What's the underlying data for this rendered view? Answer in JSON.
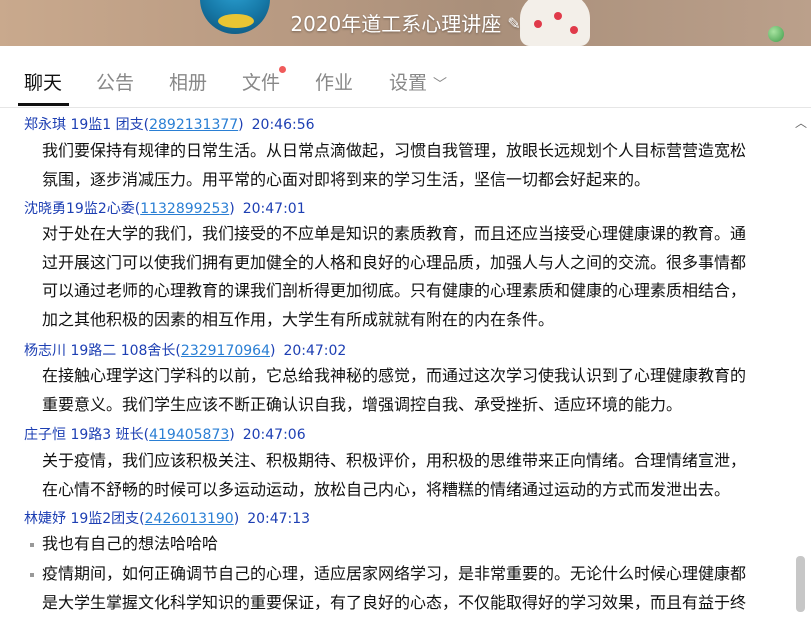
{
  "header": {
    "title": "2020年道工系心理讲座",
    "edit_icon": "pencil-icon"
  },
  "tabs": [
    {
      "label": "聊天",
      "active": true
    },
    {
      "label": "公告",
      "active": false
    },
    {
      "label": "相册",
      "active": false
    },
    {
      "label": "文件",
      "active": false,
      "badge_dot": true
    },
    {
      "label": "作业",
      "active": false
    },
    {
      "label": "设置",
      "active": false,
      "has_dropdown": true
    }
  ],
  "messages": [
    {
      "sender": "郑永琪 19监1 团支(",
      "qq": "2892131377",
      "sender_suffix": ")",
      "time": "20:46:56",
      "lines": [
        "我们要保持有规律的日常生活。从日常点滴做起，习惯自我管理，放眼长远规划个人目标营营造宽松",
        "氛围，逐步消减压力。用平常的心面对即将到来的学习生活，坚信一切都会好起来的。"
      ]
    },
    {
      "sender": "沈晓勇19监2心委(",
      "qq": "1132899253",
      "sender_suffix": ")",
      "time": "20:47:01",
      "lines": [
        "对于处在大学的我们，我们接受的不应单是知识的素质教育，而且还应当接受心理健康课的教育。通",
        "过开展这门可以使我们拥有更加健全的人格和良好的心理品质，加强人与人之间的交流。很多事情都",
        "可以通过老师的心理教育的课我们剖析得更加彻底。只有健康的心理素质和健康的心理素质相结合，",
        "加之其他积极的因素的相互作用，大学生有所成就就有附在的内在条件。"
      ]
    },
    {
      "sender": "杨志川  19路二  108舍长(",
      "qq": "2329170964",
      "sender_suffix": ")",
      "time": "20:47:02",
      "lines": [
        "在接触心理学这门学科的以前，它总给我神秘的感觉，而通过这次学习使我认识到了心理健康教育的",
        "重要意义。我们学生应该不断正确认识自我，增强调控自我、承受挫折、适应环境的能力。"
      ]
    },
    {
      "sender": "庄子恒 19路3 班长(",
      "qq": "419405873",
      "sender_suffix": ")",
      "time": "20:47:06",
      "lines": [
        "关于疫情，我们应该积极关注、积极期待、积极评价，用积极的思维带来正向情绪。合理情绪宣泄，",
        "在心情不舒畅的时候可以多运动运动，放松自己内心，将糟糕的情绪通过运动的方式而发泄出去。"
      ]
    },
    {
      "sender": "林婕妤 19监2团支(",
      "qq": "2426013190",
      "sender_suffix": ")",
      "time": "20:47:13",
      "items": [
        "我也有自己的想法哈哈哈",
        "疫情期间，如何正确调节自己的心理，适应居家网络学习，是非常重要的。无论什么时候心理健康都",
        "是大学生掌握文化科学知识的重要保证，有了良好的心态，不仅能取得好的学习效果，而且有益于终"
      ]
    }
  ]
}
